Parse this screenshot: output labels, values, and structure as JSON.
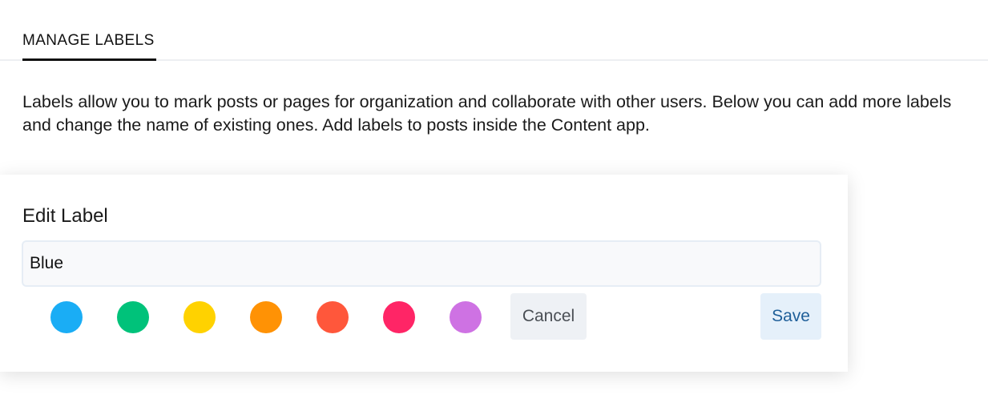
{
  "tabs": [
    {
      "label": "MANAGE LABELS",
      "active": true
    }
  ],
  "description": "Labels allow you to mark posts or pages for organization and collaborate with other users. Below you can add more labels and change the name of existing ones. Add labels to posts inside the Content app.",
  "edit_label": {
    "title": "Edit Label",
    "name_value": "Blue",
    "colors": [
      {
        "name": "blue",
        "hex": "#1aadf5"
      },
      {
        "name": "green",
        "hex": "#00c27a"
      },
      {
        "name": "yellow",
        "hex": "#ffd200"
      },
      {
        "name": "orange",
        "hex": "#ff9205"
      },
      {
        "name": "red-orange",
        "hex": "#ff573b"
      },
      {
        "name": "pink",
        "hex": "#ff2566"
      },
      {
        "name": "purple",
        "hex": "#ce72e3"
      }
    ],
    "cancel_label": "Cancel",
    "save_label": "Save"
  }
}
